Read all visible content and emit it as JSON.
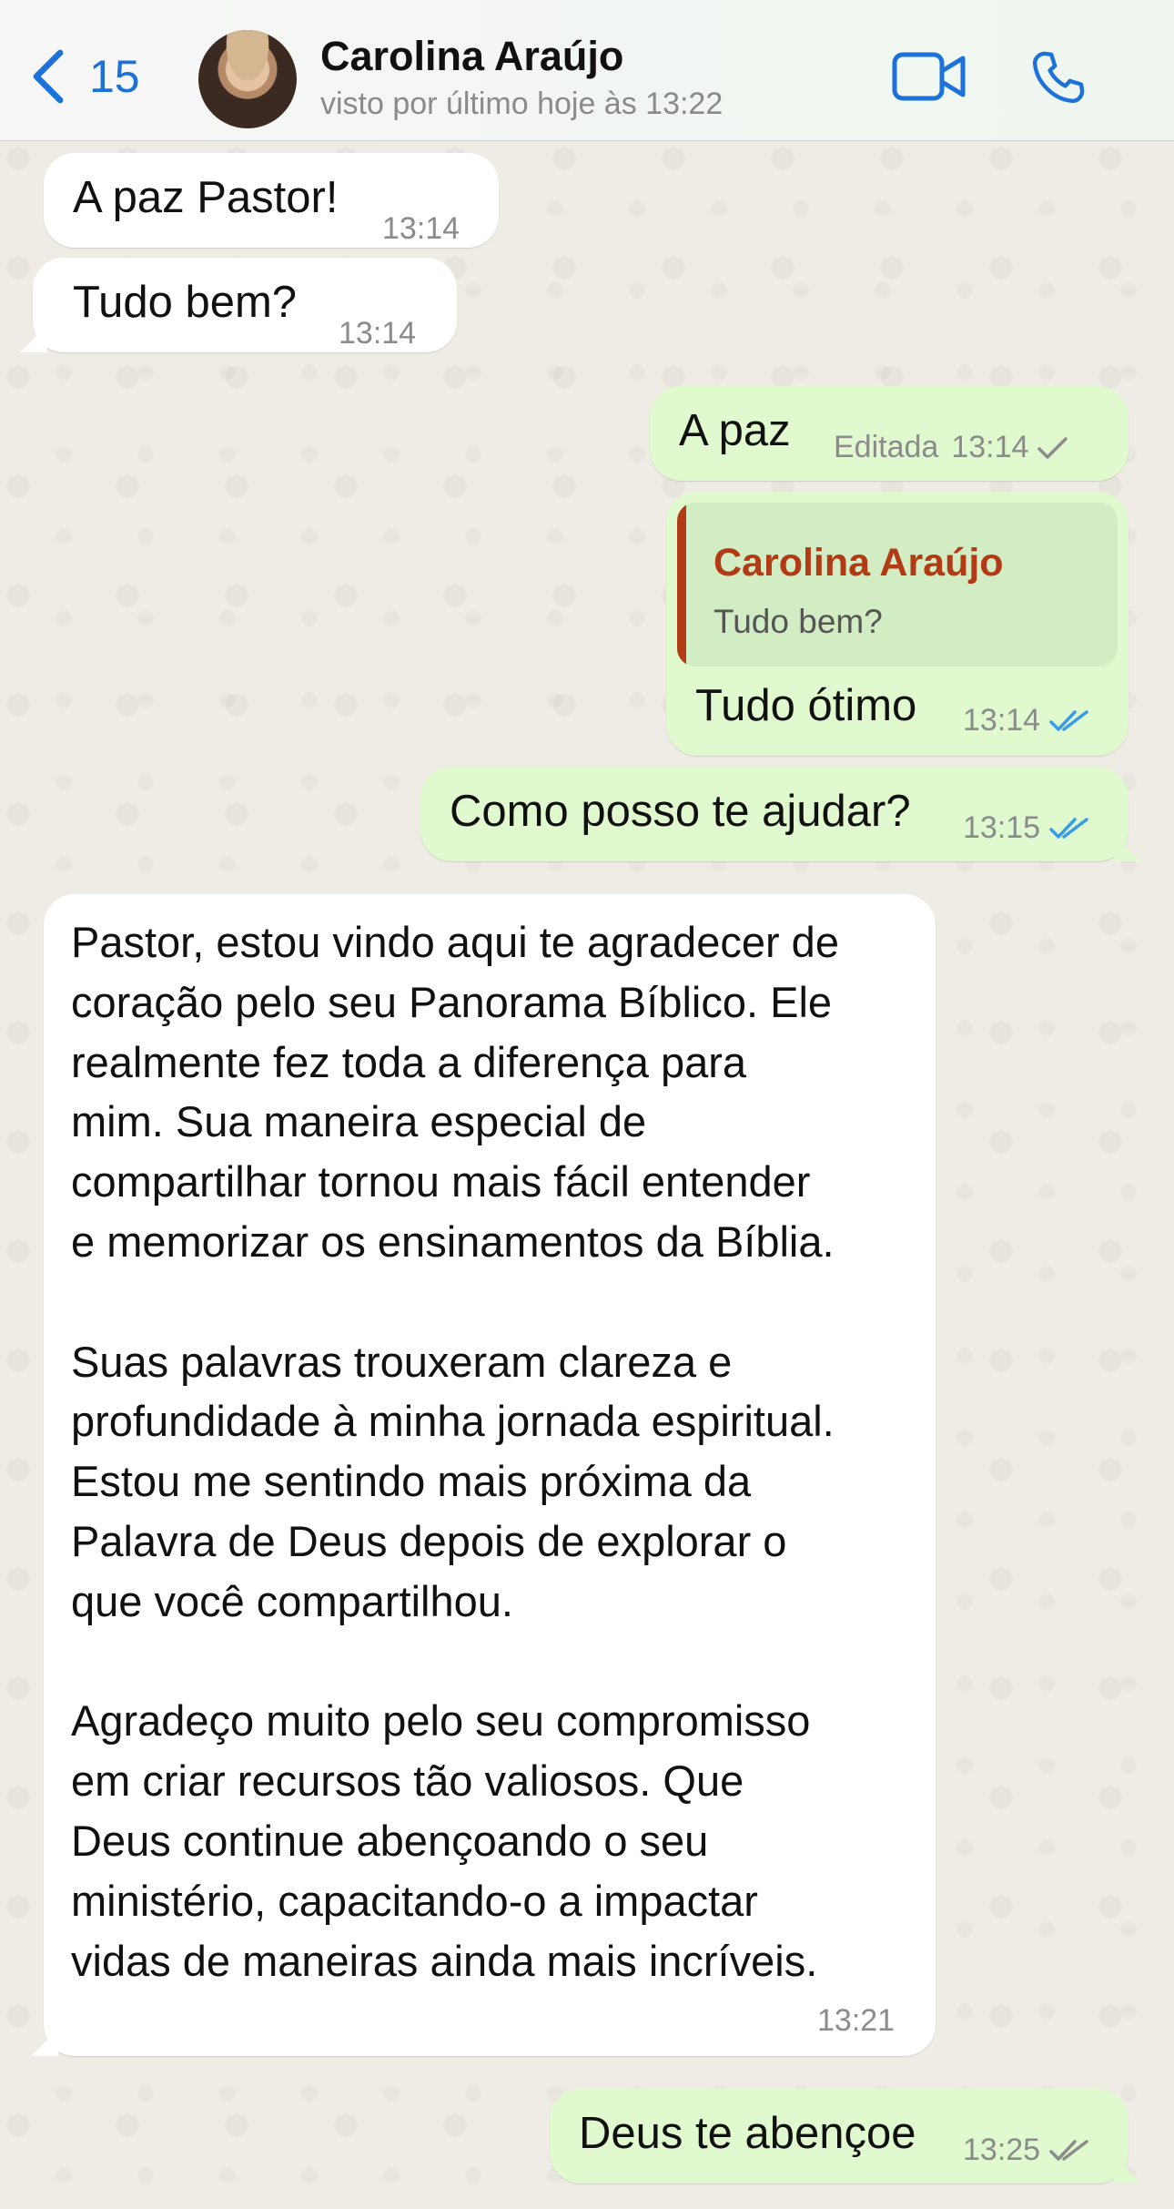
{
  "header": {
    "back_count": "15",
    "contact_name": "Carolina Araújo",
    "contact_status": "visto por último hoje às 13:22",
    "accent_color": "#1d72d9",
    "icons": [
      "chevron-left-icon",
      "video-camera-icon",
      "phone-icon"
    ]
  },
  "messages": [
    {
      "direction": "in",
      "text": "A paz Pastor!",
      "time": "13:14"
    },
    {
      "direction": "in",
      "text": "Tudo bem?",
      "time": "13:14"
    },
    {
      "direction": "out",
      "text": "A paz",
      "edited_label": "Editada",
      "time": "13:14",
      "status": "sent"
    },
    {
      "direction": "out",
      "quote": {
        "author": "Carolina Araújo",
        "text": "Tudo bem?"
      },
      "text": "Tudo ótimo",
      "time": "13:14",
      "status": "read"
    },
    {
      "direction": "out",
      "text": "Como posso te ajudar?",
      "time": "13:15",
      "status": "read"
    },
    {
      "direction": "in",
      "text": "Pastor, estou vindo aqui te agradecer de\ncoração pelo seu Panorama Bíblico. Ele\nrealmente fez toda a diferença para\nmim. Sua maneira especial de\ncompartilhar tornou mais fácil entender\ne memorizar os ensinamentos da Bíblia.\n\nSuas palavras trouxeram clareza e\nprofundidade à minha jornada espiritual.\nEstou me sentindo mais próxima da\nPalavra de Deus depois de explorar o\nque você compartilhou.\n\nAgradeço muito pelo seu compromisso\nem criar recursos tão valiosos. Que\nDeus continue abençoando o seu\nministério, capacitando-o a impactar\nvidas de maneiras ainda mais incríveis.",
      "time": "13:21"
    },
    {
      "direction": "out",
      "text": "Deus te abençoe",
      "time": "13:25",
      "status": "delivered"
    }
  ],
  "colors": {
    "incoming_bubble": "#ffffff",
    "outgoing_bubble": "#e1f9cf",
    "read_tick": "#3a9be8",
    "unread_tick": "#8b8b8b",
    "quote_author": "#b23a14"
  }
}
